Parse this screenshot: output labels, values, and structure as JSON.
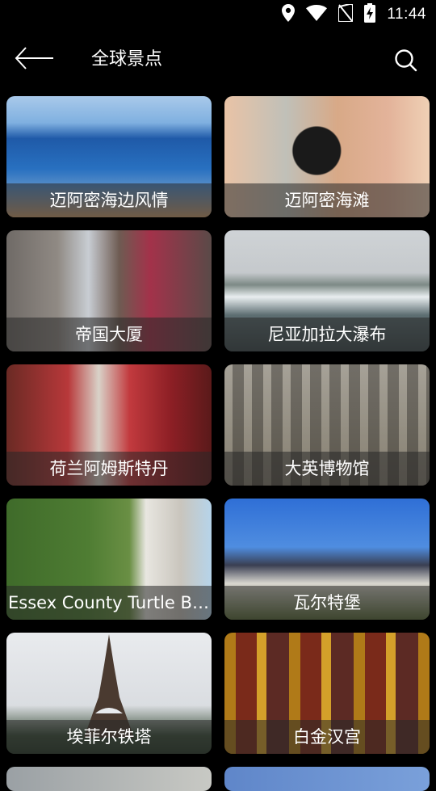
{
  "status": {
    "time": "11:44",
    "icons": [
      "location-icon",
      "wifi-icon",
      "no-sim-icon",
      "battery-charging-icon"
    ]
  },
  "appbar": {
    "title": "全球景点",
    "back_icon": "back-arrow-icon",
    "search_icon": "search-icon"
  },
  "attractions": [
    {
      "name": "迈阿密海边风情"
    },
    {
      "name": "迈阿密海滩"
    },
    {
      "name": "帝国大厦"
    },
    {
      "name": "尼亚加拉大瀑布"
    },
    {
      "name": "荷兰阿姆斯特丹"
    },
    {
      "name": "大英博物馆"
    },
    {
      "name": "Essex County Turtle Back Zoo"
    },
    {
      "name": "瓦尔特堡"
    },
    {
      "name": "埃菲尔铁塔"
    },
    {
      "name": "白金汉宫"
    }
  ]
}
